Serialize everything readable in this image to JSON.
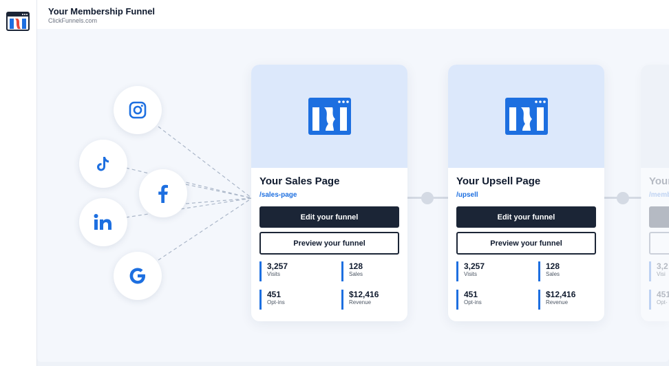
{
  "header": {
    "title": "Your Membership Funnel",
    "subtitle": "ClickFunnels.com"
  },
  "social_sources": [
    "instagram-icon",
    "tiktok-icon",
    "facebook-icon",
    "linkedin-icon",
    "google-icon"
  ],
  "colors": {
    "accent": "#1d6fe0",
    "dark_button": "#1b2536",
    "card_header_bg": "#dce8fb",
    "canvas_bg": "#f4f7fc"
  },
  "cards": [
    {
      "title": "Your Sales Page",
      "path": "/sales-page",
      "edit_label": "Edit your funnel",
      "preview_label": "Preview your funnel",
      "stats": [
        {
          "value": "3,257",
          "label": "Visits"
        },
        {
          "value": "128",
          "label": "Sales"
        },
        {
          "value": "451",
          "label": "Opt-ins"
        },
        {
          "value": "$12,416",
          "label": "Revenue"
        }
      ]
    },
    {
      "title": "Your Upsell Page",
      "path": "/upsell",
      "edit_label": "Edit your funnel",
      "preview_label": "Preview your funnel",
      "stats": [
        {
          "value": "3,257",
          "label": "Visits"
        },
        {
          "value": "128",
          "label": "Sales"
        },
        {
          "value": "451",
          "label": "Opt-ins"
        },
        {
          "value": "$12,416",
          "label": "Revenue"
        }
      ]
    },
    {
      "title": "Your",
      "path": "/memb",
      "stats": [
        {
          "value": "3,2",
          "label": "Visi"
        },
        {
          "value": "451",
          "label": "Opt-"
        }
      ]
    }
  ]
}
